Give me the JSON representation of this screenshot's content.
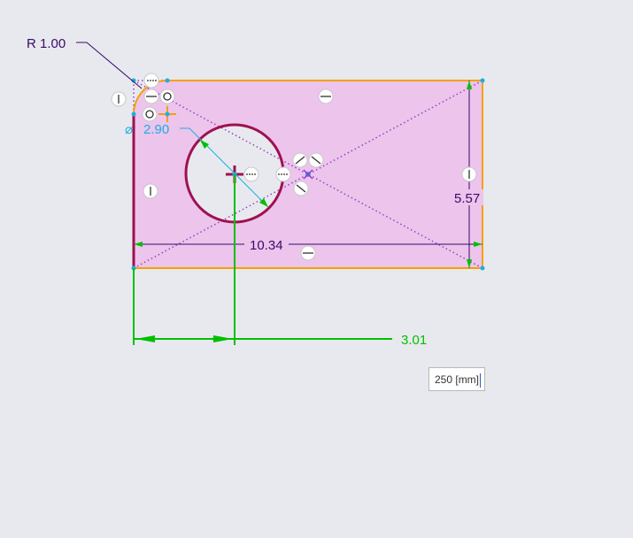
{
  "dimensions": {
    "fillet_radius": "R 1.00",
    "hole_diameter": "2.90",
    "diameter_symbol": "⌀",
    "width": "10.34",
    "height": "5.57",
    "hole_offset": "3.01"
  },
  "input": {
    "value": "250 [mm]"
  },
  "colors": {
    "profile": "#f5a000",
    "selected": "#a0104f",
    "fill": "#ecc4ec",
    "dim": "#3a0a6a",
    "driving": "#00c000",
    "diameter": "#1ab0e0"
  }
}
